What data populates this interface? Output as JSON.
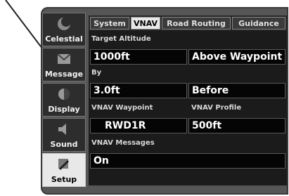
{
  "tabs": [
    "System",
    "VNAV",
    "Road Routing",
    "Guidance"
  ],
  "active_tab": "VNAV",
  "sidebar": [
    {
      "label": "Celestial",
      "icon": "moon-icon"
    },
    {
      "label": "Message",
      "icon": "message-icon"
    },
    {
      "label": "Display",
      "icon": "display-icon"
    },
    {
      "label": "Sound",
      "icon": "sound-icon"
    },
    {
      "label": "Setup",
      "icon": "wrench-icon"
    }
  ],
  "fields": {
    "target_altitude_label": "Target Altitude",
    "target_altitude_value": "1000ft",
    "target_altitude_ref": "Above Waypoint",
    "by_label": "By",
    "by_value": "3.0ft",
    "by_ref": "Before",
    "vnav_waypoint_label": "VNAV Waypoint",
    "vnav_waypoint_value": "RWD1R",
    "vnav_profile_label": "VNAV Profile",
    "vnav_profile_value": "500ft",
    "vnav_messages_label": "VNAV Messages",
    "vnav_messages_value": "On"
  }
}
